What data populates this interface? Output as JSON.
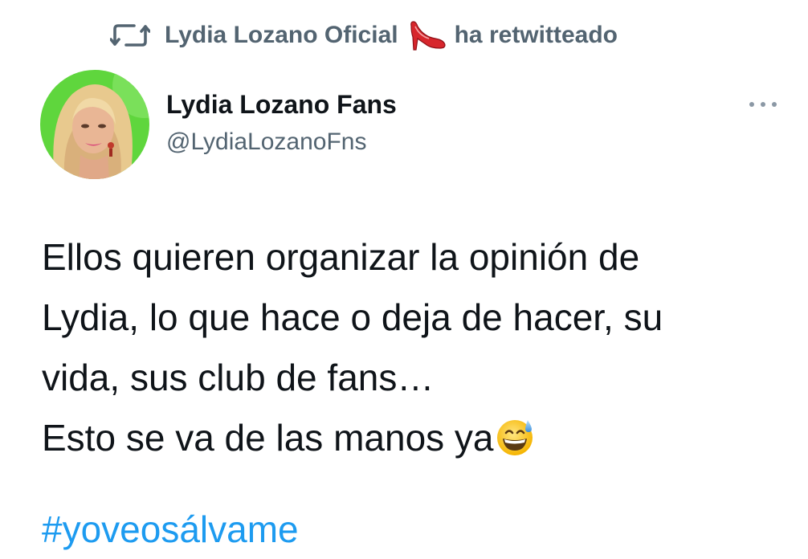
{
  "retweet": {
    "icon": "retweet-icon",
    "retweeter_name": "Lydia Lozano Oficial",
    "retweeter_emoji": "high-heel-icon",
    "action_text": "ha retwitteado"
  },
  "author": {
    "avatar": "avatar",
    "display_name": "Lydia Lozano Fans",
    "handle": "@LydiaLozanoFns"
  },
  "more_menu": {
    "icon": "more-horizontal-icon"
  },
  "tweet": {
    "lines": [
      "Ellos quieren organizar la opinión de",
      "Lydia, lo que hace o deja de hacer, su",
      "vida, sus club de fans…",
      "Esto se va de las manos ya"
    ],
    "trailing_emoji": "grinning-sweat-emoji-icon",
    "hashtag": "#yoveosálvame"
  },
  "colors": {
    "text_primary": "#0f1419",
    "text_secondary": "#536471",
    "link": "#1d9bf0",
    "background": "#ffffff"
  }
}
